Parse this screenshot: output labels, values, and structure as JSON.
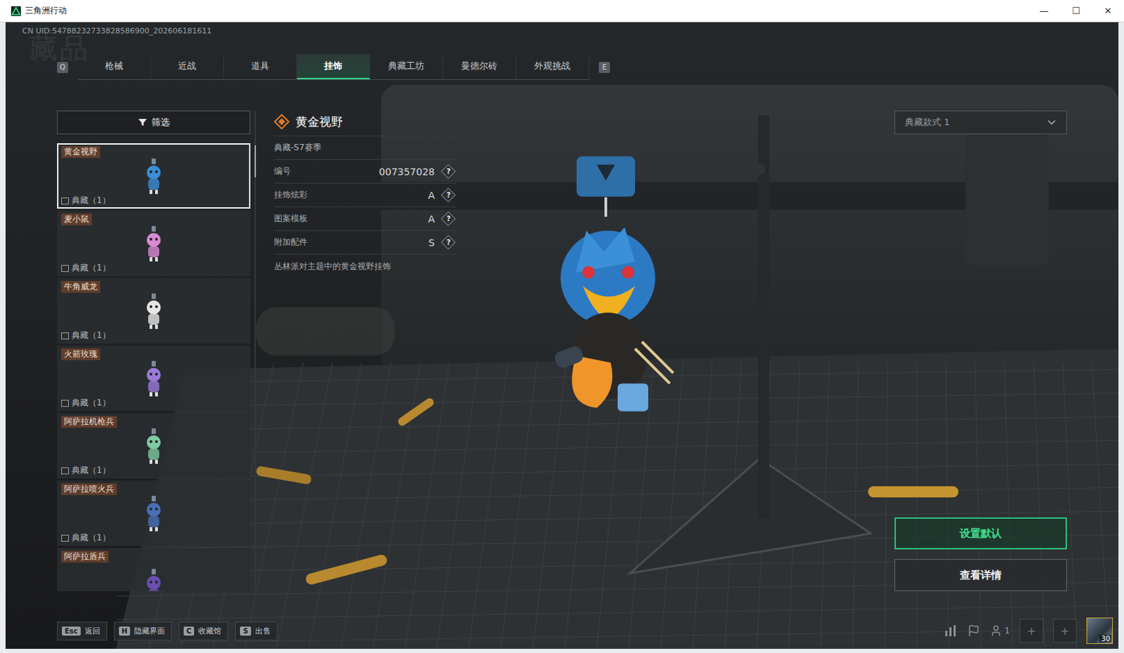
{
  "window": {
    "title": "三角洲行动",
    "controls": [
      "—",
      "☐",
      "✕"
    ]
  },
  "uid": "CN UID:54788232733828586900_202606181611",
  "page_title": "藏品",
  "tabs": {
    "prev_key": "Q",
    "next_key": "E",
    "items": [
      {
        "label": "枪械",
        "selected": false
      },
      {
        "label": "近战",
        "selected": false
      },
      {
        "label": "道具",
        "selected": false
      },
      {
        "label": "挂饰",
        "selected": true
      },
      {
        "label": "典藏工坊",
        "selected": false
      },
      {
        "label": "曼德尔砖",
        "selected": false
      },
      {
        "label": "外观挑战",
        "selected": false
      }
    ]
  },
  "filter": {
    "label": "筛选"
  },
  "items": [
    {
      "name": "黄金视野",
      "tag": "典藏（1）",
      "selected": true,
      "color": "#3a8fd6"
    },
    {
      "name": "麦小鼠",
      "tag": "典藏（1）",
      "selected": false,
      "color": "#d98ad6"
    },
    {
      "name": "牛角威龙",
      "tag": "典藏（1）",
      "selected": false,
      "color": "#e6e6e6"
    },
    {
      "name": "火箭玫瑰",
      "tag": "典藏（1）",
      "selected": false,
      "color": "#9b7ad8"
    },
    {
      "name": "阿萨拉机枪兵",
      "tag": "典藏（1）",
      "selected": false,
      "color": "#7fc8a0"
    },
    {
      "name": "阿萨拉喷火兵",
      "tag": "典藏（1）",
      "selected": false,
      "color": "#4a6fb8"
    },
    {
      "name": "阿萨拉盾兵",
      "selected": false,
      "color": "#6a4fb0"
    }
  ],
  "detail": {
    "name": "黄金视野",
    "season": "典藏-S7赛季",
    "rows": [
      {
        "label": "编号",
        "value": "007357028",
        "help": "?"
      },
      {
        "label": "挂饰炫彩",
        "value": "A",
        "help": "?"
      },
      {
        "label": "图案模板",
        "value": "A",
        "help": "?"
      },
      {
        "label": "附加配件",
        "value": "S",
        "help": "?"
      }
    ],
    "description": "丛林派对主题中的黄金视野挂饰"
  },
  "style_select": {
    "value": "典藏款式 1"
  },
  "buttons": [
    {
      "label": "设置默认",
      "primary": true
    },
    {
      "label": "查看详情",
      "primary": false
    }
  ],
  "hotkeys": [
    {
      "key": "Esc",
      "label": "返回"
    },
    {
      "key": "H",
      "label": "隐藏界面"
    },
    {
      "key": "C",
      "label": "收藏馆"
    },
    {
      "key": "S",
      "label": "出售"
    }
  ],
  "status": {
    "party_count": "1",
    "slots": [
      "+",
      "+"
    ],
    "level": "30"
  }
}
